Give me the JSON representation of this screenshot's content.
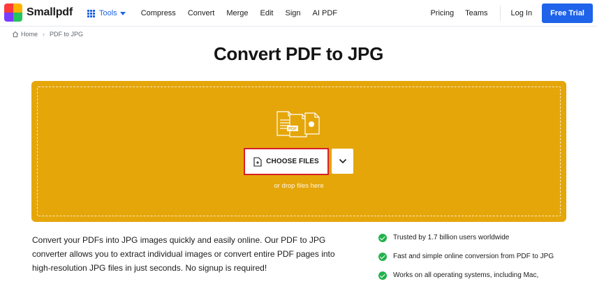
{
  "header": {
    "brand": "Smallpdf",
    "nav": {
      "tools": "Tools",
      "items": [
        "Compress",
        "Convert",
        "Merge",
        "Edit",
        "Sign",
        "AI PDF"
      ]
    },
    "right": {
      "pricing": "Pricing",
      "teams": "Teams",
      "login": "Log In",
      "trial": "Free Trial"
    }
  },
  "breadcrumb": {
    "home": "Home",
    "current": "PDF to JPG"
  },
  "page_title": "Convert PDF to JPG",
  "dropzone": {
    "choose_files": "CHOOSE FILES",
    "hint": "or drop files here",
    "illustration_badge": "PDF",
    "background_color": "#e5a60a"
  },
  "description": "Convert your PDFs into JPG images quickly and easily online. Our PDF to JPG converter allows you to extract individual images or convert entire PDF pages into high-resolution JPG files in just seconds. No signup is required!",
  "features": [
    "Trusted by 1.7 billion users worldwide",
    "Fast and simple online conversion from PDF to JPG",
    "Works on all operating systems, including Mac,"
  ],
  "colors": {
    "accent": "#1e63e9",
    "check": "#22b24c",
    "highlight_border": "#d62128"
  }
}
